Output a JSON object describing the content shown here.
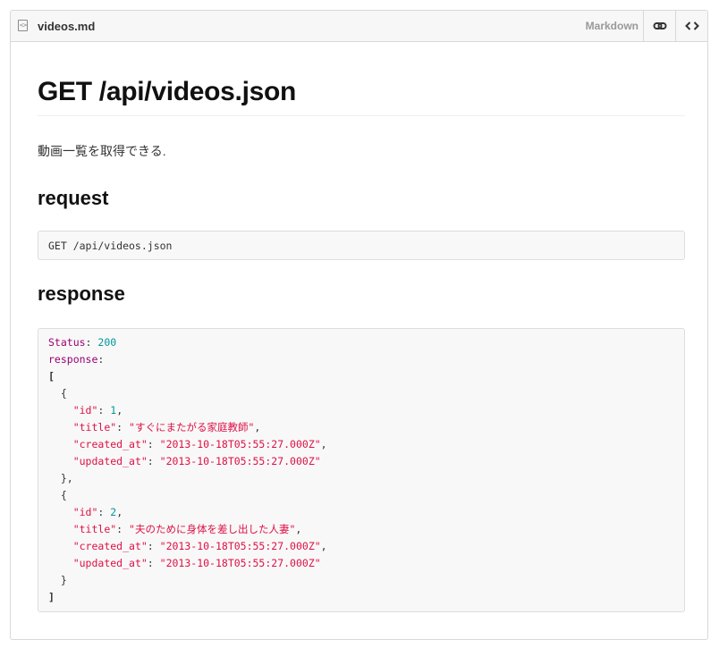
{
  "file": {
    "name": "videos.md",
    "type_label": "Markdown",
    "icon": "file-code-icon",
    "actions": [
      {
        "icon": "link-icon",
        "name": "permalink"
      },
      {
        "icon": "code-icon",
        "name": "view-source"
      }
    ]
  },
  "doc": {
    "title": "GET /api/videos.json",
    "description": "動画一覧を取得できる.",
    "request_heading": "request",
    "request_code": "GET /api/videos.json",
    "response_heading": "response",
    "response": {
      "status_key": "Status",
      "status_value": "200",
      "response_key": "response",
      "open_bracket": "[",
      "close_bracket": "]",
      "open_brace": "{",
      "close_brace_comma": "},",
      "close_brace": "}",
      "field_keys": {
        "id": "\"id\"",
        "title": "\"title\"",
        "created_at": "\"created_at\"",
        "updated_at": "\"updated_at\""
      },
      "items": [
        {
          "id": "1",
          "title": "\"すぐにまたがる家庭教師\"",
          "created_at": "\"2013-10-18T05:55:27.000Z\"",
          "updated_at": "\"2013-10-18T05:55:27.000Z\""
        },
        {
          "id": "2",
          "title": "\"夫のために身体を差し出した人妻\"",
          "created_at": "\"2013-10-18T05:55:27.000Z\"",
          "updated_at": "\"2013-10-18T05:55:27.000Z\""
        }
      ]
    }
  },
  "colors": {
    "key": "#990073",
    "number": "#009999",
    "string": "#dd1144",
    "header_bg": "#f7f7f7",
    "code_bg": "#f8f8f8"
  }
}
